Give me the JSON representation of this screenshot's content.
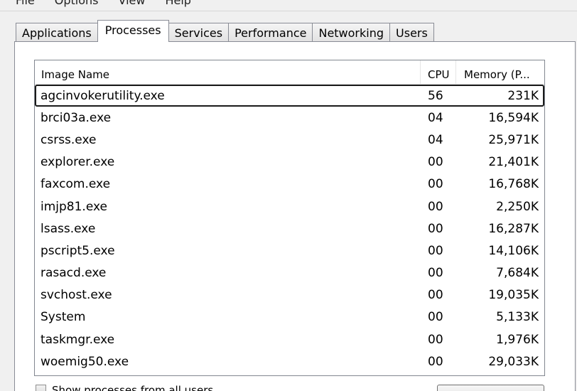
{
  "menu": {
    "items": [
      "File",
      "Options",
      "View",
      "Help"
    ]
  },
  "tabs": [
    {
      "label": "Applications",
      "active": false
    },
    {
      "label": "Processes",
      "active": true
    },
    {
      "label": "Services",
      "active": false
    },
    {
      "label": "Performance",
      "active": false
    },
    {
      "label": "Networking",
      "active": false
    },
    {
      "label": "Users",
      "active": false
    }
  ],
  "process_list": {
    "columns": {
      "name": "Image Name",
      "cpu": "CPU",
      "memory": "Memory (P..."
    },
    "selected_row": 0,
    "rows": [
      {
        "name": "agcinvokerutility.exe",
        "cpu": "56",
        "memory": "231K"
      },
      {
        "name": "brci03a.exe",
        "cpu": "04",
        "memory": "16,594K"
      },
      {
        "name": "csrss.exe",
        "cpu": "04",
        "memory": "25,971K"
      },
      {
        "name": "explorer.exe",
        "cpu": "00",
        "memory": "21,401K"
      },
      {
        "name": "faxcom.exe",
        "cpu": "00",
        "memory": "16,768K"
      },
      {
        "name": "imjp81.exe",
        "cpu": "00",
        "memory": "2,250K"
      },
      {
        "name": "lsass.exe",
        "cpu": "00",
        "memory": "16,287K"
      },
      {
        "name": "pscript5.exe",
        "cpu": "00",
        "memory": "14,106K"
      },
      {
        "name": "rasacd.exe",
        "cpu": "00",
        "memory": "7,684K"
      },
      {
        "name": "svchost.exe",
        "cpu": "00",
        "memory": "19,035K"
      },
      {
        "name": "System",
        "cpu": "00",
        "memory": "5,133K"
      },
      {
        "name": "taskmgr.exe",
        "cpu": "00",
        "memory": "1,976K"
      },
      {
        "name": "woemig50.exe",
        "cpu": "00",
        "memory": "29,033K"
      }
    ]
  },
  "bottom": {
    "show_all_users_label": "Show processes from all users",
    "show_all_users_checked": false
  }
}
